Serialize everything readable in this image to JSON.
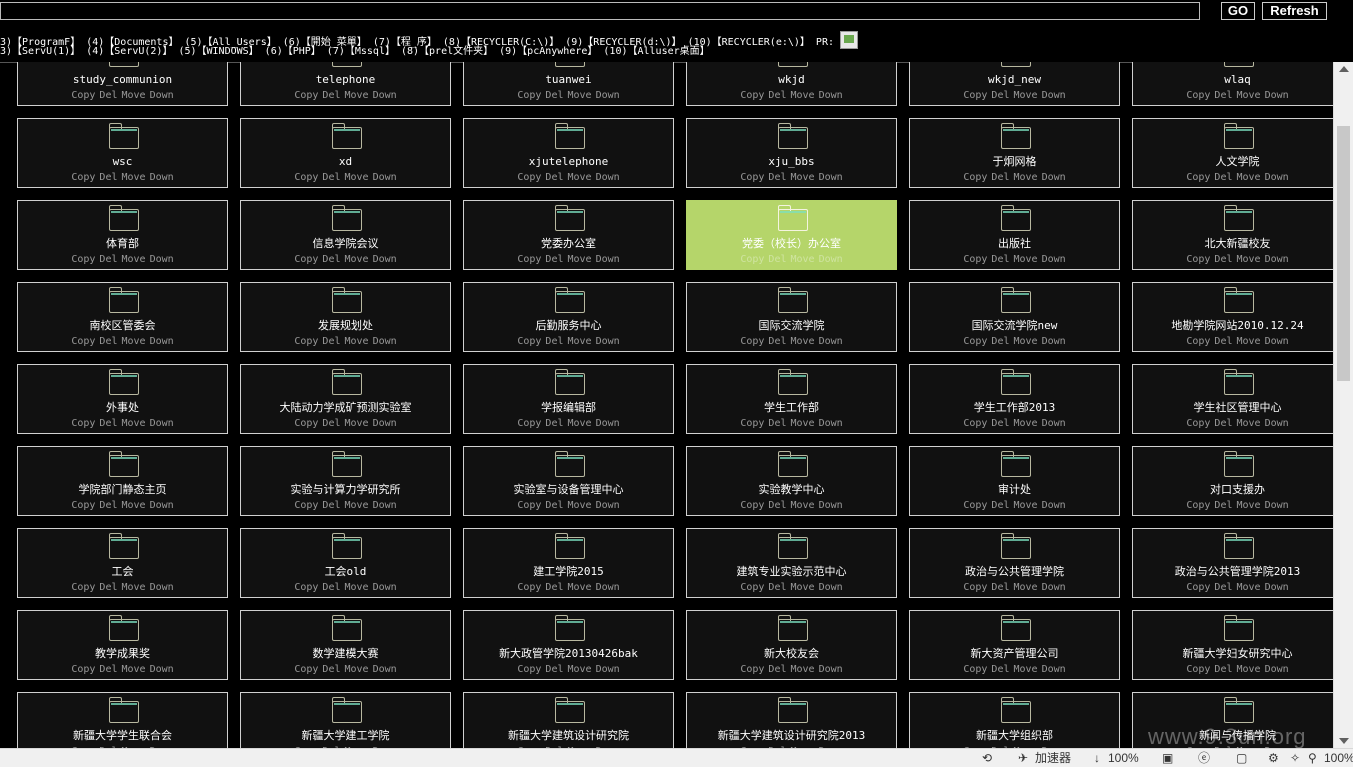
{
  "toolbar": {
    "path_value": "",
    "go_label": "GO",
    "refresh_label": "Refresh"
  },
  "shortcuts_row1": [
    "3)【ProgramF】",
    "(4)【Documents】",
    "(5)【All_Users】",
    "(6)【開始_菜單】",
    "(7)【程_序】",
    "(8)【RECYCLER(C:\\)】",
    "(9)【RECYCLER(d:\\)】",
    "(10)【RECYCLER(e:\\)】",
    "PR:"
  ],
  "shortcuts_row2": [
    "3)【ServU(1)】",
    "(4)【ServU(2)】",
    "(5)【WINDOWS】",
    "(6)【PHP】",
    "(7)【Mssql】",
    "(8)【prel文件夹】",
    "(9)【pcAnywhere】",
    "(10)【Alluser桌面】"
  ],
  "actions": {
    "copy": "Copy",
    "del": "Del",
    "move": "Move",
    "down": "Down"
  },
  "folders": [
    "study_communion",
    "telephone",
    "tuanwei",
    "wkjd",
    "wkjd_new",
    "wlaq",
    "wsc",
    "xd",
    "xjutelephone",
    "xju_bbs",
    "于炯网格",
    "人文学院",
    "体育部",
    "信息学院会议",
    "党委办公室",
    "党委（校长）办公室",
    "出版社",
    "北大新疆校友",
    "南校区管委会",
    "发展规划处",
    "后勤服务中心",
    "国际交流学院",
    "国际交流学院new",
    "地勘学院网站2010.12.24",
    "外事处",
    "大陆动力学成矿预测实验室",
    "学报编辑部",
    "学生工作部",
    "学生工作部2013",
    "学生社区管理中心",
    "学院部门静态主页",
    "实验与计算力学研究所",
    "实验室与设备管理中心",
    "实验教学中心",
    "审计处",
    "对口支援办",
    "工会",
    "工会old",
    "建工学院2015",
    "建筑专业实验示范中心",
    "政治与公共管理学院",
    "政治与公共管理学院2013",
    "教学成果奖",
    "数学建模大赛",
    "新大政管学院20130426bak",
    "新大校友会",
    "新大资产管理公司",
    "新疆大学妇女研究中心",
    "新疆大学学生联合会",
    "新疆大学建工学院",
    "新疆大学建筑设计研究院",
    "新疆大学建筑设计研究院2013",
    "新疆大学组织部",
    "新闻与传播学院"
  ],
  "active_folder": "党委（校长）办公室",
  "statusbar": {
    "accelerator": "加速器",
    "zoom_left": "100%",
    "zoom_right": "100%"
  },
  "watermark": "www.9.3un.org"
}
